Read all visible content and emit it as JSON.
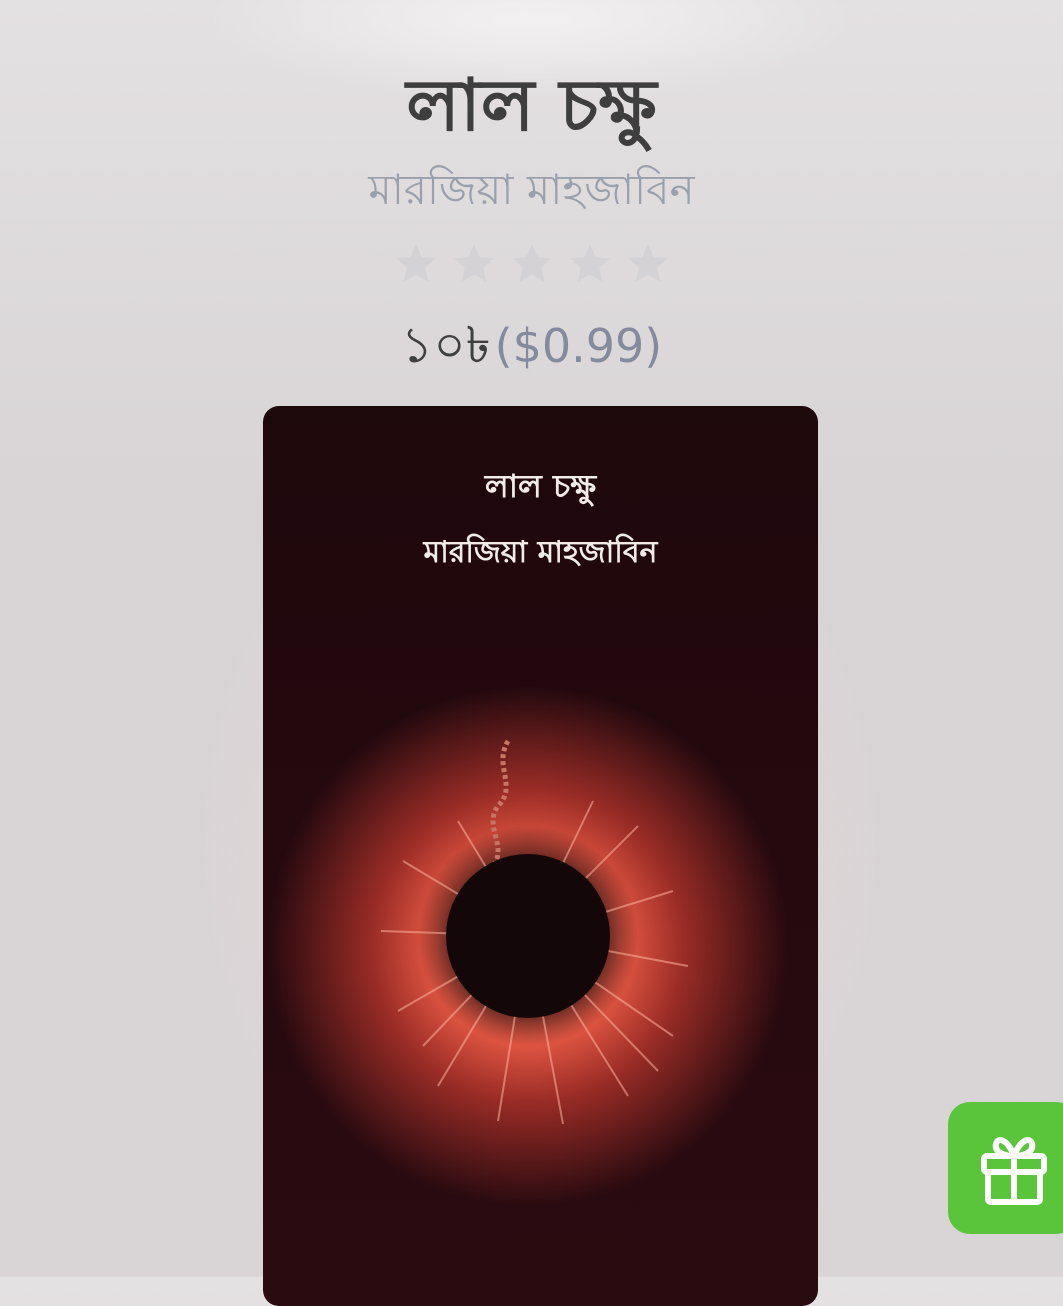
{
  "book": {
    "title": "লাল চক্ষু",
    "author": "মারজিয়া মাহজাবিন",
    "rating": {
      "value": 0,
      "max": 5
    },
    "price": {
      "local": "১০৳",
      "usd": "($0.99)"
    },
    "cover": {
      "title": "লাল চক্ষু",
      "author": "মারজিয়া মাহজাবিন"
    }
  },
  "colors": {
    "title": "#3e3e3e",
    "author": "#9aa0ab",
    "star_empty": "#d4d2d4",
    "price_usd": "#858b9e",
    "gift_button": "#5ac53a"
  },
  "icons": {
    "rating": "star-icon",
    "gift": "gift-icon"
  }
}
